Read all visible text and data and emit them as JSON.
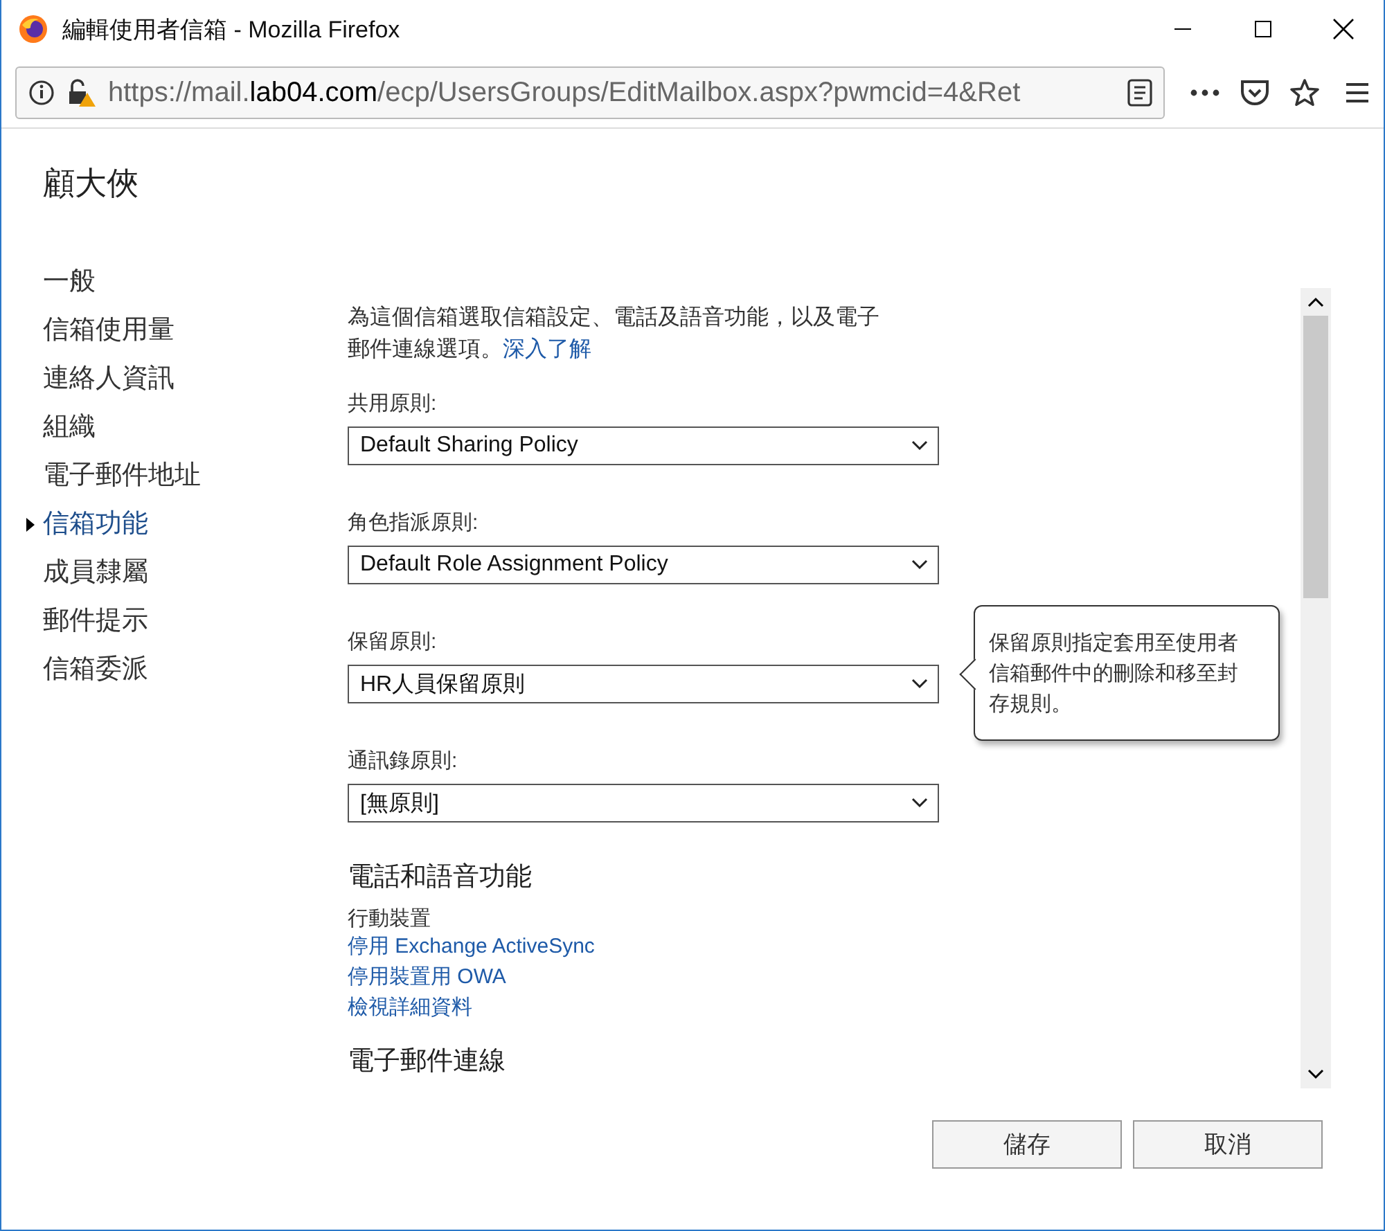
{
  "window": {
    "title": "編輯使用者信箱 - Mozilla Firefox"
  },
  "address_bar": {
    "prefix": "https://mail.",
    "domain": "lab04.com",
    "rest": "/ecp/UsersGroups/EditMailbox.aspx?pwmcid=4&Ret"
  },
  "user_name": "顧大俠",
  "nav": [
    {
      "label": "一般",
      "selected": false
    },
    {
      "label": "信箱使用量",
      "selected": false
    },
    {
      "label": "連絡人資訊",
      "selected": false
    },
    {
      "label": "組織",
      "selected": false
    },
    {
      "label": "電子郵件地址",
      "selected": false
    },
    {
      "label": "信箱功能",
      "selected": true
    },
    {
      "label": "成員隸屬",
      "selected": false
    },
    {
      "label": "郵件提示",
      "selected": false
    },
    {
      "label": "信箱委派",
      "selected": false
    }
  ],
  "intro": {
    "text": "為這個信箱選取信箱設定、電話及語音功能，以及電子郵件連線選項。",
    "link": "深入了解"
  },
  "fields": [
    {
      "label": "共用原則:",
      "value": "Default Sharing Policy"
    },
    {
      "label": "角色指派原則:",
      "value": "Default Role Assignment Policy"
    },
    {
      "label": "保留原則:",
      "value": "HR人員保留原則",
      "tooltip": "保留原則指定套用至使用者信箱郵件中的刪除和移至封存規則。"
    },
    {
      "label": "通訊錄原則:",
      "value": "[無原則]"
    }
  ],
  "phone_section": {
    "heading": "電話和語音功能",
    "subheading": "行動裝置",
    "links": [
      "停用 Exchange ActiveSync",
      "停用裝置用 OWA",
      "檢視詳細資料"
    ]
  },
  "email_section": {
    "heading": "電子郵件連線"
  },
  "buttons": [
    "儲存",
    "取消"
  ]
}
